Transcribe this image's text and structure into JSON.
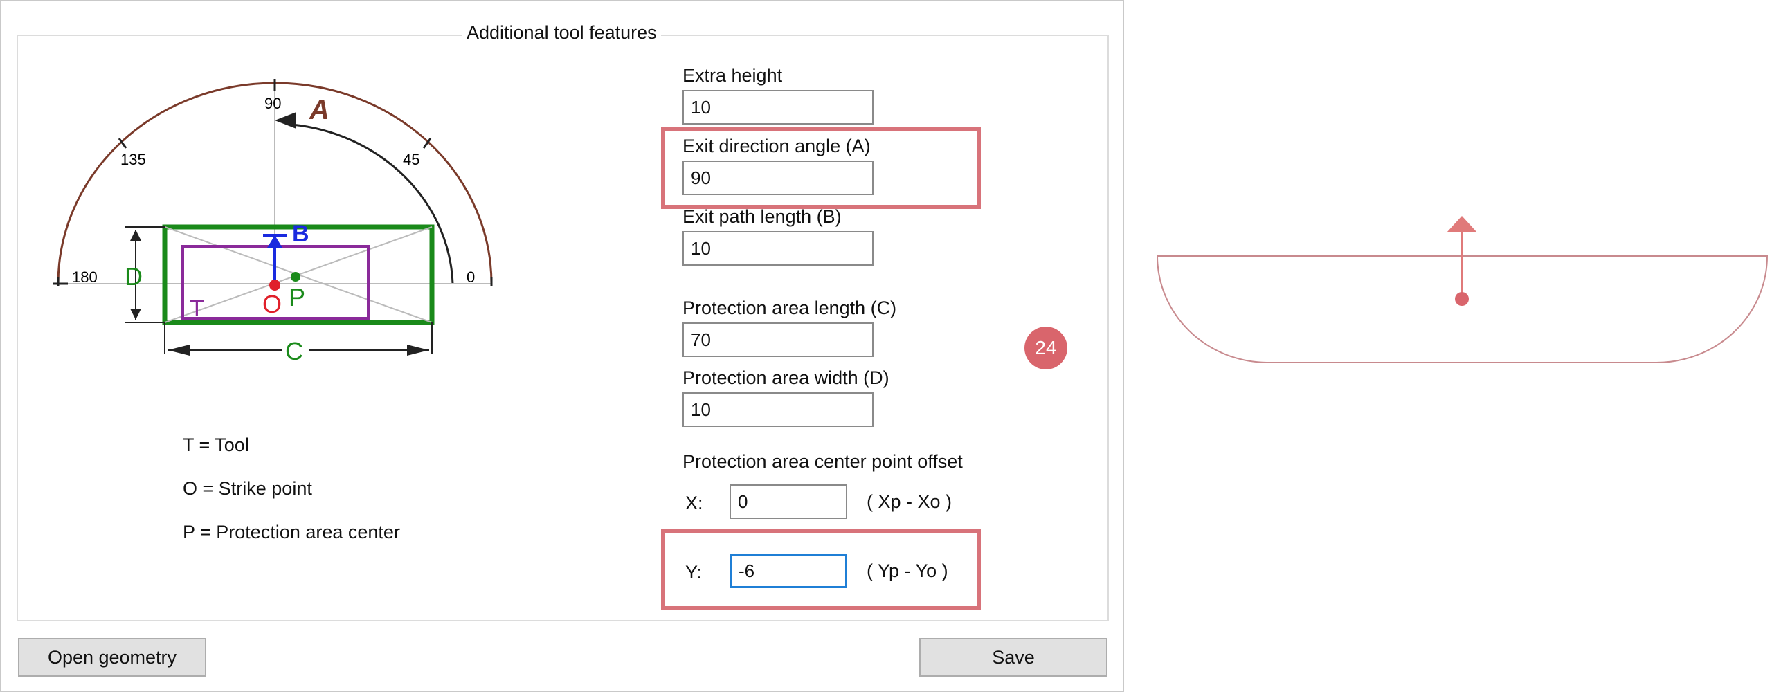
{
  "group_title": "Additional tool features",
  "diagram": {
    "tick_90": "90",
    "tick_135": "135",
    "tick_45": "45",
    "tick_180": "180",
    "tick_0": "0",
    "letter_a": "A",
    "letter_b": "B",
    "letter_c": "C",
    "letter_d": "D",
    "letter_t": "T",
    "letter_o": "O",
    "letter_p": "P"
  },
  "legend": {
    "tool": "T = Tool",
    "strike": "O = Strike point",
    "center": "P = Protection area center"
  },
  "fields": {
    "extra_height": {
      "label": "Extra height",
      "value": "10"
    },
    "exit_angle": {
      "label": "Exit direction angle (A)",
      "value": "90"
    },
    "exit_length": {
      "label": "Exit path length (B)",
      "value": "10"
    },
    "area_length": {
      "label": "Protection area length (C)",
      "value": "70"
    },
    "area_width": {
      "label": "Protection area width (D)",
      "value": "10"
    },
    "offset_title": "Protection area center point offset",
    "x": {
      "label": "X:",
      "value": "0",
      "hint": "( Xp - Xo )"
    },
    "y": {
      "label": "Y:",
      "value": "-6",
      "hint": "( Yp - Yo )"
    }
  },
  "badge": "24",
  "buttons": {
    "open": "Open geometry",
    "save": "Save"
  },
  "colors": {
    "highlight": "#d8737a",
    "green": "#1a8a1a",
    "purple": "#8a2a9a",
    "blue": "#1a2adf",
    "red": "#e0202a",
    "arc": "#7a3a2a"
  },
  "icons": {
    "preview_arrow": "up-arrow-icon",
    "preview_dot": "strike-point-icon"
  }
}
